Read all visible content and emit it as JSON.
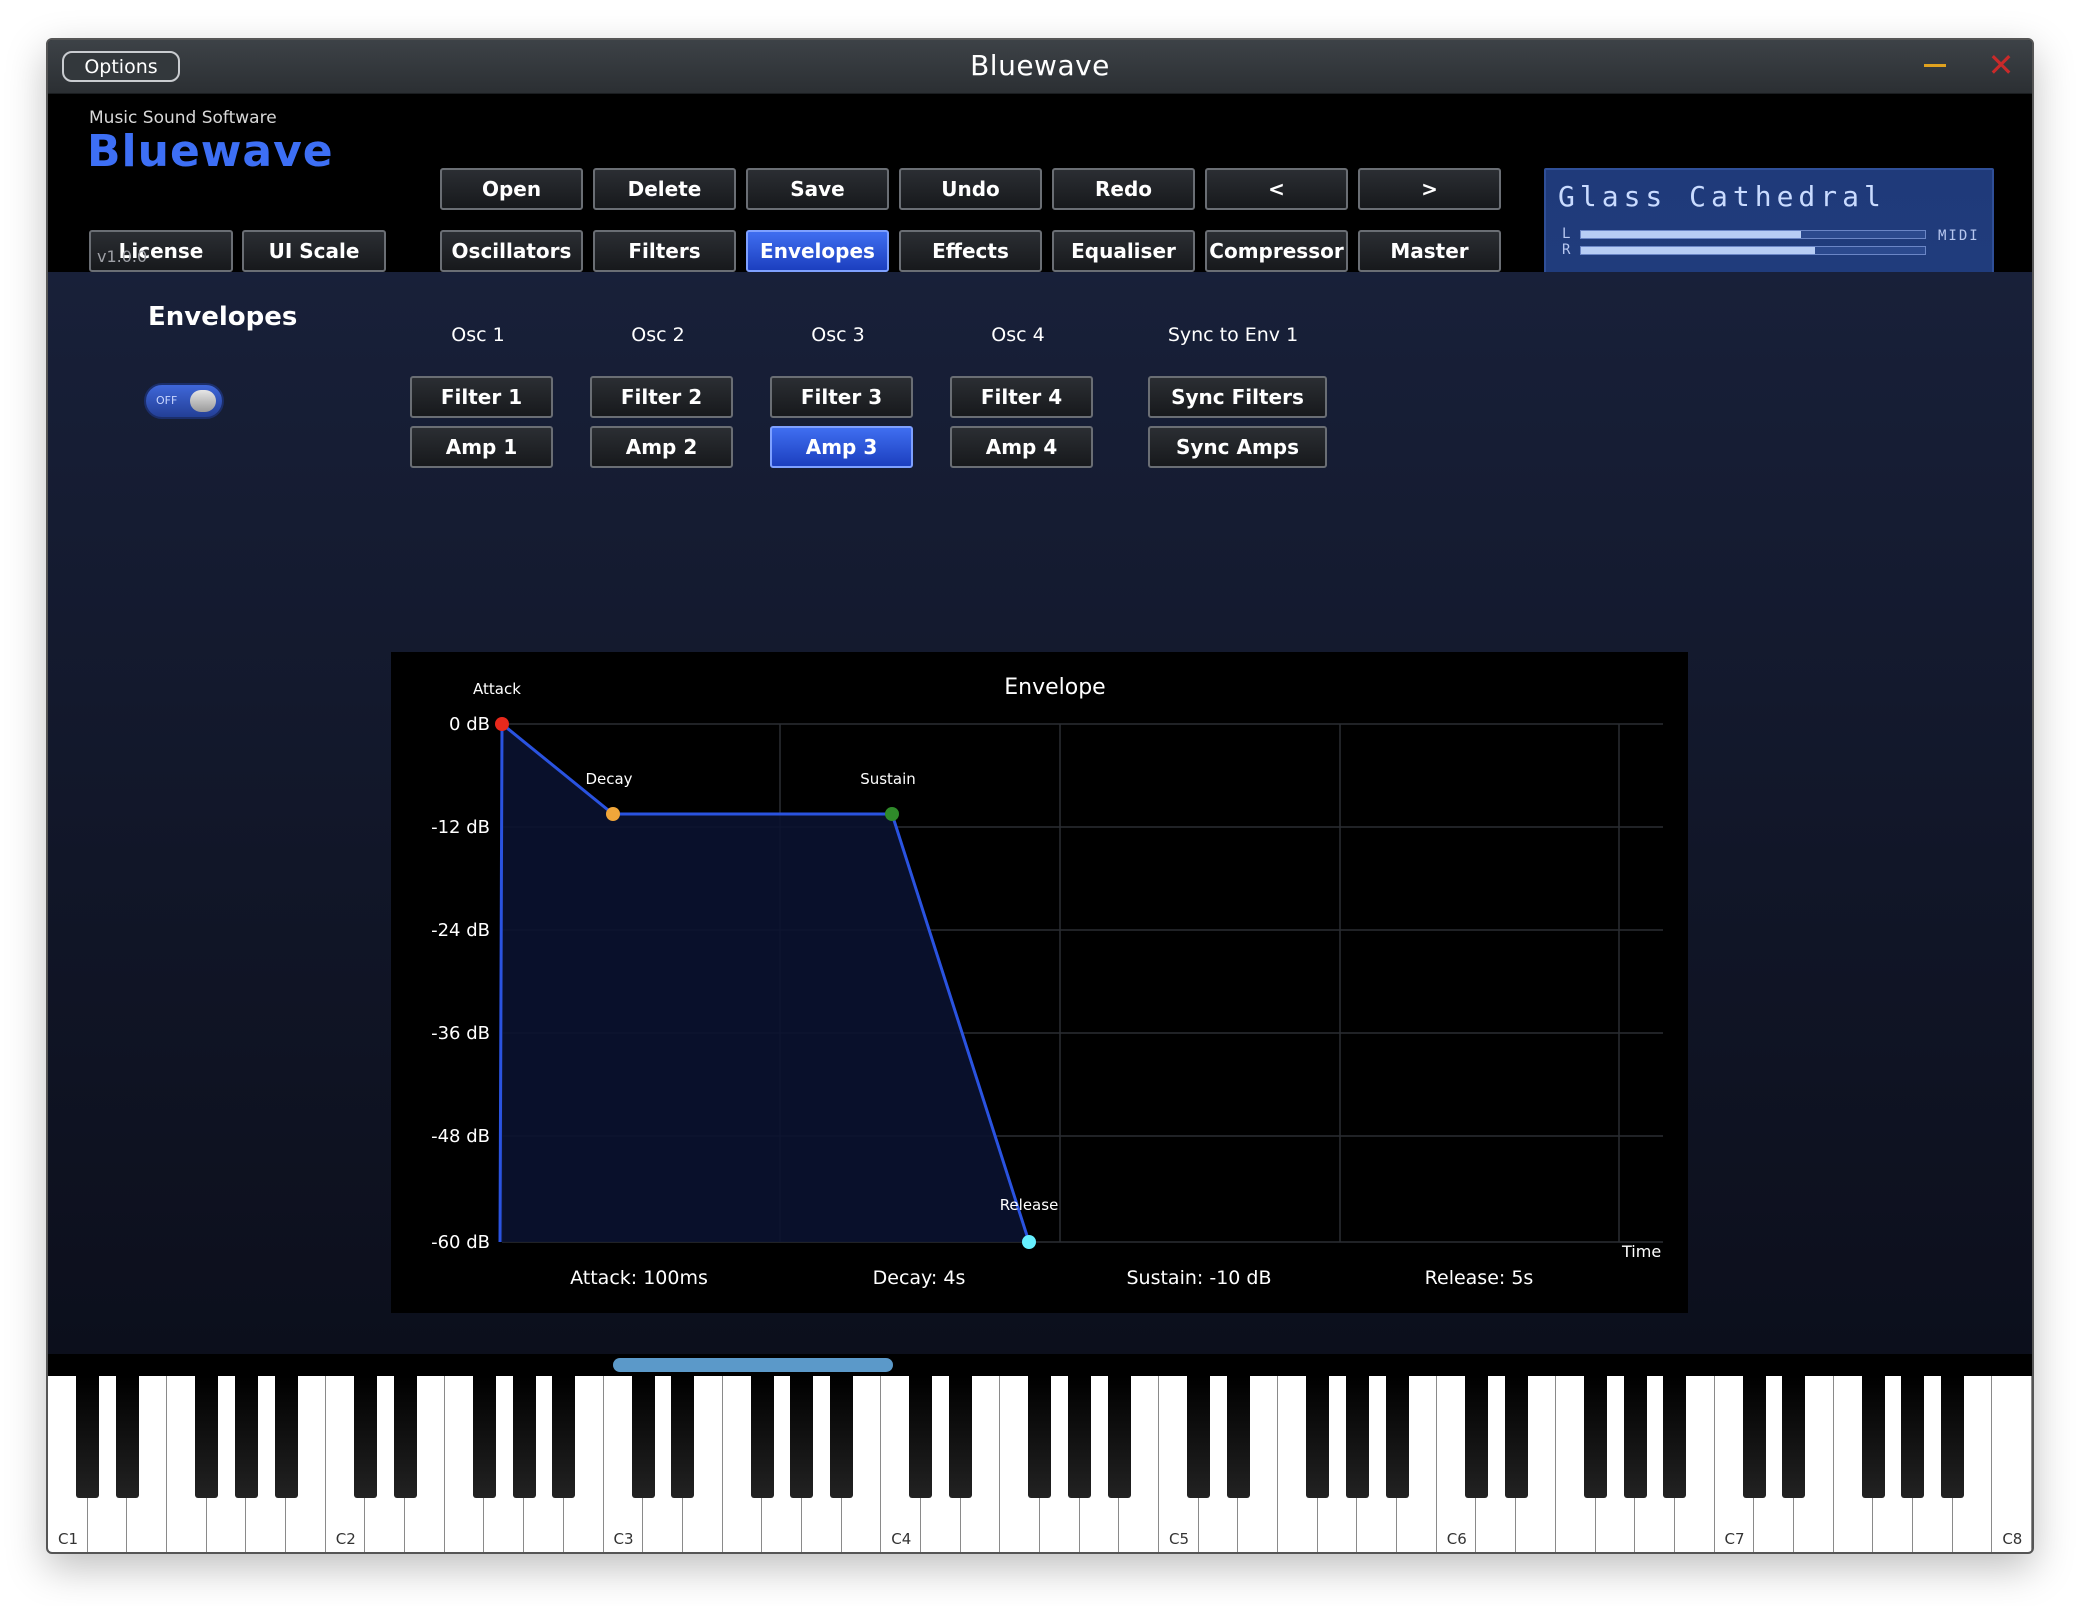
{
  "window": {
    "title": "Bluewave",
    "options_label": "Options"
  },
  "brand": {
    "company": "Music Sound Software",
    "product": "Bluewave",
    "version": "v1.0.0"
  },
  "header_buttons": {
    "license": "License",
    "ui_scale": "UI Scale",
    "open": "Open",
    "delete": "Delete",
    "save": "Save",
    "undo": "Undo",
    "redo": "Redo",
    "prev": "<",
    "next": ">"
  },
  "tabs": [
    {
      "label": "Oscillators",
      "active": false
    },
    {
      "label": "Filters",
      "active": false
    },
    {
      "label": "Envelopes",
      "active": true
    },
    {
      "label": "Effects",
      "active": false
    },
    {
      "label": "Equaliser",
      "active": false
    },
    {
      "label": "Compressor",
      "active": false
    },
    {
      "label": "Master",
      "active": false
    }
  ],
  "preset": {
    "name": "Glass Cathedral",
    "left_label": "L",
    "right_label": "R",
    "midi_label": "MIDI",
    "level_left": 0.64,
    "level_right": 0.68
  },
  "envelopes": {
    "title": "Envelopes",
    "toggle_label": "OFF",
    "columns": [
      {
        "head": "Osc 1",
        "filter": "Filter 1",
        "amp": "Amp 1"
      },
      {
        "head": "Osc 2",
        "filter": "Filter 2",
        "amp": "Amp 2"
      },
      {
        "head": "Osc 3",
        "filter": "Filter 3",
        "amp": "Amp 3"
      },
      {
        "head": "Osc 4",
        "filter": "Filter 4",
        "amp": "Amp 4"
      }
    ],
    "sync": {
      "head": "Sync to Env 1",
      "filters": "Sync Filters",
      "amps": "Sync Amps"
    },
    "selected": "Amp 3"
  },
  "envelope_graph": {
    "title": "Envelope",
    "y_ticks": [
      "0 dB",
      "-12 dB",
      "-24 dB",
      "-36 dB",
      "-48 dB",
      "-60 dB"
    ],
    "x_axis_label": "Time",
    "point_labels": {
      "attack": "Attack",
      "decay": "Decay",
      "sustain": "Sustain",
      "release": "Release"
    },
    "readouts": {
      "attack": "Attack: 100ms",
      "decay": "Decay: 4s",
      "sustain": "Sustain: -10 dB",
      "release": "Release: 5s"
    },
    "points_db": {
      "attack": 0,
      "decay": -10,
      "sustain": -10,
      "release": -60
    },
    "colors": {
      "line": "#2a53e0",
      "attack": "#e8291c",
      "decay": "#f0a63a",
      "sustain": "#2f8a2a",
      "release": "#66f0ff"
    }
  },
  "keyboard": {
    "octave_labels": [
      "C1",
      "C2",
      "C3",
      "C4",
      "C5",
      "C6",
      "C7",
      "C8"
    ]
  }
}
